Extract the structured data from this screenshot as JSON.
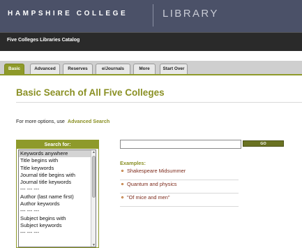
{
  "header": {
    "college": "HAMPSHIRE COLLEGE",
    "library": "LIBRARY"
  },
  "catalog_bar": {
    "title": "Five Colleges Libraries Catalog"
  },
  "tabs": [
    {
      "label": "Basic",
      "active": true
    },
    {
      "label": "Advanced",
      "active": false
    },
    {
      "label": "Reserves",
      "active": false
    },
    {
      "label": "e/Journals",
      "active": false
    },
    {
      "label": "More",
      "active": false
    },
    {
      "label": "Start Over",
      "active": false
    }
  ],
  "page": {
    "title": "Basic Search of All Five Colleges",
    "hint_prefix": "For more options, use",
    "hint_link": "Advanced Search"
  },
  "search_for": {
    "header": "Search for:",
    "options": [
      "Keywords anywhere",
      "Title begins with",
      "Title keywords",
      "Journal title begins with",
      "Journal title keywords",
      "--- --- ---",
      "Author (last name first)",
      "Author keywords",
      "--- --- ---",
      "Subject begins with",
      "Subject keywords",
      "--- --- ---"
    ],
    "selected_index": 0
  },
  "search": {
    "value": "",
    "go_label": "GO"
  },
  "examples": {
    "title": "Examples:",
    "items": [
      "Shakespeare Midsummer",
      "Quantum and physics",
      "\"Of mice and men\""
    ]
  },
  "colors": {
    "header_bg": "#4b5168",
    "accent": "#8e9a2a",
    "example_text": "#7d2b1c"
  }
}
